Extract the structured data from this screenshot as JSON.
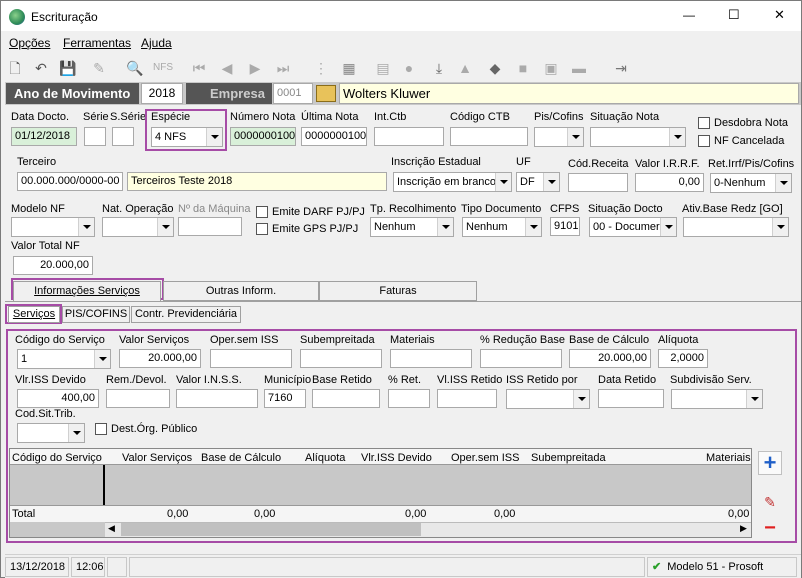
{
  "window": {
    "title": "Escrituração",
    "min": "—",
    "max": "☐",
    "close": "✕"
  },
  "menu": [
    "Opções",
    "Ferramentas",
    "Ajuda"
  ],
  "top": {
    "ano_label": "Ano de Movimento",
    "ano_value": "2018",
    "empresa_label": "Empresa",
    "empresa_code": "0001",
    "empresa_name": "Wolters Kluwer"
  },
  "row1": {
    "data_docto_label": "Data Docto.",
    "data_docto": "01/12/2018",
    "serie_label": "Série",
    "sserie_label": "S.Série",
    "especie_label": "Espécie",
    "especie": "4 NFS",
    "numero_label": "Número Nota",
    "numero": "0000000100",
    "ultima_label": "Última Nota",
    "ultima": "0000000100",
    "intctb_label": "Int.Ctb",
    "codctb_label": "Código CTB",
    "piscofins_label": "Pis/Cofins",
    "situacao_label": "Situação Nota",
    "desdobra_label": "Desdobra Nota",
    "nfcancelada_label": "NF Cancelada"
  },
  "row2": {
    "terceiro_label": "Terceiro",
    "terceiro_code": "00.000.000/0000-00",
    "terceiro_name": "Terceiros Teste 2018",
    "ie_label": "Inscrição Estadual",
    "ie": "Inscrição em branco",
    "uf_label": "UF",
    "uf": "DF",
    "codreceita_label": "Cód.Receita",
    "irrf_label": "Valor I.R.R.F.",
    "irrf": "0,00",
    "ret_label": "Ret.Irrf/Pis/Cofins",
    "ret": "0-Nenhum"
  },
  "row3": {
    "modelo_label": "Modelo NF",
    "natop_label": "Nat. Operação",
    "nmaq_label": "Nº da Máquina",
    "darf_label": "Emite DARF PJ/PJ",
    "gps_label": "Emite GPS PJ/PJ",
    "tprec_label": "Tp. Recolhimento",
    "tprec": "Nenhum",
    "tpdoc_label": "Tipo Documento",
    "tpdoc": "Nenhum",
    "cfps_label": "CFPS",
    "cfps": "9101",
    "sitdocto_label": "Situação Docto",
    "sitdocto": "00 - Documer",
    "ativ_label": "Ativ.Base Redz [GO]"
  },
  "row4": {
    "vtotal_label": "Valor Total NF",
    "vtotal": "20.000,00"
  },
  "tabs": [
    "Informações Serviços",
    "Outras Inform.",
    "Faturas"
  ],
  "subtabs": [
    "Serviços",
    "PIS/COFINS",
    "Contr. Previdenciária"
  ],
  "serv": {
    "cod_label": "Código do Serviço",
    "cod": "1",
    "valor_label": "Valor Serviços",
    "valor": "20.000,00",
    "opersem_label": "Oper.sem ISS",
    "subemp_label": "Subempreitada",
    "materiais_label": "Materiais",
    "reducao_label": "% Redução Base",
    "base_label": "Base de Cálculo",
    "base": "20.000,00",
    "aliq_label": "Alíquota",
    "aliq": "2,0000",
    "vlriss_label": "Vlr.ISS Devido",
    "vlriss": "400,00",
    "rem_label": "Rem./Devol.",
    "inss_label": "Valor I.N.S.S.",
    "mun_label": "Município",
    "mun": "7160",
    "baseret_label": "Base Retido",
    "pret_label": "% Ret.",
    "vlissret_label": "Vl.ISS Retido",
    "issretpor_label": "ISS Retido por",
    "dataret_label": "Data Retido",
    "subdiv_label": "Subdivisão Serv.",
    "codsit_label": "Cod.Sit.Trib.",
    "destorg_label": "Dest.Órg. Público"
  },
  "grid": {
    "headers": [
      "Código do Serviço",
      "Valor Serviços",
      "Base de Cálculo",
      "Alíquota",
      "Vlr.ISS Devido",
      "Oper.sem ISS",
      "Subempreitada",
      "Materiais"
    ],
    "total_label": "Total",
    "totals": [
      "0,00",
      "0,00",
      "0,00",
      "0,00",
      "0,00"
    ]
  },
  "status": {
    "date": "13/12/2018",
    "time": "12:06",
    "model": "Modelo 51 - Prosoft"
  }
}
